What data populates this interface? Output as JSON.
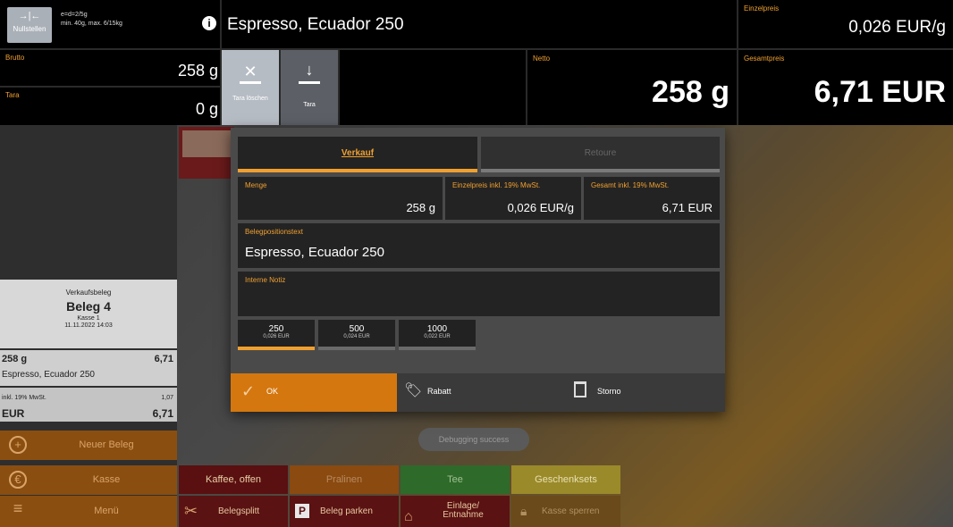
{
  "header": {
    "nullstellen_label": "Nullstellen",
    "scale_info_line1": "e=d=2/5g",
    "scale_info_line2": "min. 40g, max. 6/15kg",
    "product_name": "Espresso, Ecuador 250",
    "einzelpreis_label": "Einzelpreis",
    "einzelpreis_value": "0,026 EUR/g",
    "brutto_label": "Brutto",
    "brutto_value": "258 g",
    "tara_label": "Tara",
    "tara_value": "0 g",
    "tara_loeschen_label": "Tara löschen",
    "tara_button_label": "Tara",
    "netto_label": "Netto",
    "netto_value": "258 g",
    "gesamtpreis_label": "Gesamtpreis",
    "gesamtpreis_value": "6,71 EUR"
  },
  "receipt": {
    "title": "Verkaufsbeleg",
    "beleg": "Beleg 4",
    "kasse": "Kasse 1",
    "datetime": "11.11.2022 14:03",
    "item_qty": "258 g",
    "item_price": "6,71",
    "item_name": "Espresso, Ecuador 250",
    "tax_label": "inkl. 19% MwSt.",
    "tax_value": "1,07",
    "currency": "EUR",
    "total": "6,71"
  },
  "menu": {
    "neuer_beleg": "Neuer Beleg",
    "kasse": "Kasse",
    "menu": "Menü"
  },
  "categories": [
    "Kaffee, offen",
    "Pralinen",
    "Tee",
    "Geschenksets"
  ],
  "bottom_bar": {
    "belegsplit": "Belegsplitt",
    "beleg_parken": "Beleg parken",
    "einlage": "Einlage/ Entnahme",
    "kasse_sperren": "Kasse sperren"
  },
  "toast": "Debugging success",
  "dialog": {
    "tab_verkauf": "Verkauf",
    "tab_retoure": "Retoure",
    "menge_label": "Menge",
    "menge_value": "258 g",
    "einzelpreis_label": "Einzelpreis inkl. 19% MwSt.",
    "einzelpreis_value": "0,026 EUR/g",
    "gesamt_label": "Gesamt inkl. 19% MwSt.",
    "gesamt_value": "6,71 EUR",
    "belegtext_label": "Belegpositionstext",
    "belegtext_value": "Espresso, Ecuador 250",
    "notiz_label": "Interne Notiz",
    "notiz_value": "",
    "quick": [
      {
        "label": "250",
        "sub": "0,026 EUR"
      },
      {
        "label": "500",
        "sub": "0,024 EUR"
      },
      {
        "label": "1000",
        "sub": "0,022 EUR"
      }
    ],
    "ok_label": "OK",
    "rabatt_label": "Rabatt",
    "storno_label": "Storno"
  },
  "colors": {
    "accent": "#f0a030",
    "ok_bg": "#d4770f",
    "menu_bg": "#8a4e10"
  }
}
